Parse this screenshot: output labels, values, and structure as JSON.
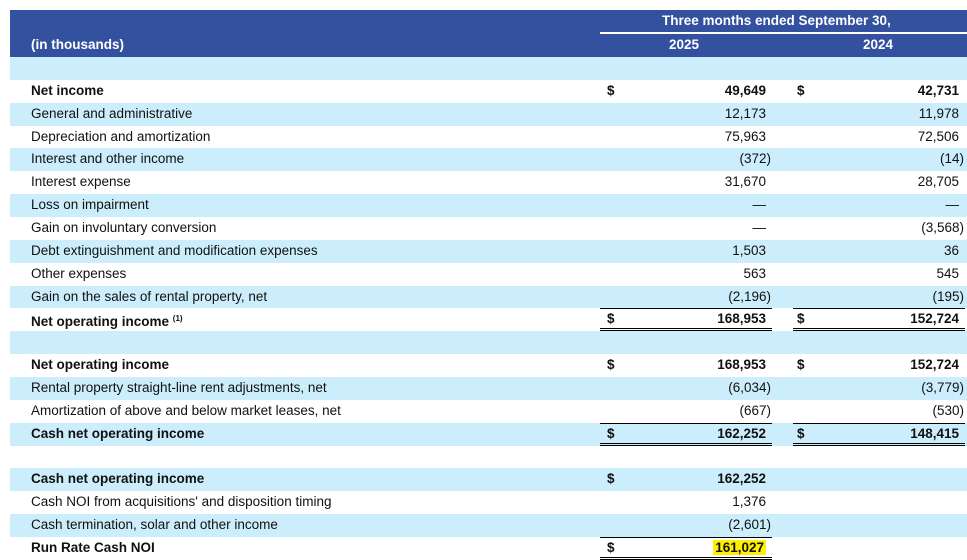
{
  "header": {
    "units": "(in thousands)",
    "period": "Three months ended September 30,",
    "col1": "2025",
    "col2": "2024"
  },
  "rows": [
    {
      "label": "",
      "blank": true
    },
    {
      "label": "Net income",
      "bold": true,
      "d1": "$",
      "v1": "49,649",
      "d2": "$",
      "v2": "42,731"
    },
    {
      "label": "General and administrative",
      "v1": "12,173",
      "v2": "11,978"
    },
    {
      "label": "Depreciation and amortization",
      "v1": "75,963",
      "v2": "72,506"
    },
    {
      "label": "Interest and other income",
      "v1": "(372)",
      "v2": "(14)"
    },
    {
      "label": "Interest expense",
      "v1": "31,670",
      "v2": "28,705"
    },
    {
      "label": "Loss on impairment",
      "v1": "—",
      "v2": "—"
    },
    {
      "label": "Gain on involuntary conversion",
      "v1": "—",
      "v2": "(3,568)"
    },
    {
      "label": "Debt extinguishment and modification expenses",
      "v1": "1,503",
      "v2": "36"
    },
    {
      "label": "Other expenses",
      "v1": "563",
      "v2": "545"
    },
    {
      "label": "Gain on the sales of rental property, net",
      "v1": "(2,196)",
      "v2": "(195)"
    },
    {
      "label": "Net operating income",
      "sup": "(1)",
      "bold": true,
      "total": true,
      "d1": "$",
      "v1": "168,953",
      "d2": "$",
      "v2": "152,724"
    },
    {
      "label": "",
      "blank": true
    },
    {
      "label": "Net operating income",
      "bold": true,
      "d1": "$",
      "v1": "168,953",
      "d2": "$",
      "v2": "152,724"
    },
    {
      "label": "Rental property straight-line rent adjustments, net",
      "v1": "(6,034)",
      "v2": "(3,779)"
    },
    {
      "label": "Amortization of above and below market leases, net",
      "v1": "(667)",
      "v2": "(530)"
    },
    {
      "label": "Cash net operating income",
      "bold": true,
      "total": true,
      "d1": "$",
      "v1": "162,252",
      "d2": "$",
      "v2": "148,415"
    },
    {
      "label": "",
      "blank": true
    },
    {
      "label": "Cash net operating income",
      "bold": true,
      "d1": "$",
      "v1": "162,252"
    },
    {
      "label": "Cash NOI from acquisitions' and disposition timing",
      "v1": "1,376"
    },
    {
      "label": "Cash termination, solar and other income",
      "v1": "(2,601)"
    },
    {
      "label": "Run Rate Cash NOI",
      "bold": true,
      "total1": true,
      "highlight": true,
      "d1": "$",
      "v1": "161,027"
    }
  ],
  "colors": {
    "header": "#3451a0",
    "band": "#cceefc",
    "highlight": "#ffef00"
  }
}
